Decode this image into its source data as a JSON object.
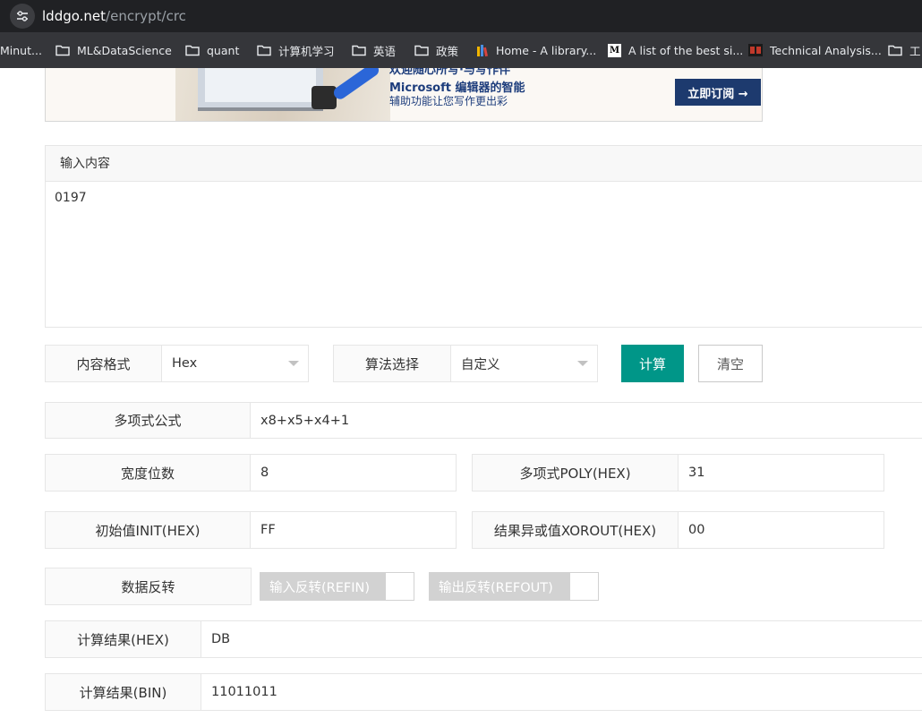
{
  "browser": {
    "url_host": "lddgo.net",
    "url_path": "/encrypt/crc",
    "bookmarks": [
      {
        "label": "Minut...",
        "icon": "none"
      },
      {
        "label": "ML&DataScience",
        "icon": "folder-icon"
      },
      {
        "label": "quant",
        "icon": "folder-icon"
      },
      {
        "label": "计算机学习",
        "icon": "folder-icon"
      },
      {
        "label": "英语",
        "icon": "folder-icon"
      },
      {
        "label": "政策",
        "icon": "folder-icon"
      },
      {
        "label": "Home - A library...",
        "icon": "library-favicon"
      },
      {
        "label": "A list of the best si...",
        "icon": "medium-favicon"
      },
      {
        "label": "Technical Analysis...",
        "icon": "ta-favicon"
      },
      {
        "label": "工",
        "icon": "folder-icon"
      }
    ]
  },
  "banner": {
    "line0": "欢迎随心所写·与写作伴",
    "line1": "Microsoft 编辑器的智能",
    "line2": "辅助功能让您写作更出彩",
    "cta": "立即订阅 →"
  },
  "input_panel": {
    "title": "输入内容",
    "value": "0197"
  },
  "options": {
    "content_format_label": "内容格式",
    "content_format_value": "Hex",
    "algorithm_label": "算法选择",
    "algorithm_value": "自定义",
    "calculate_button": "计算",
    "clear_button": "清空"
  },
  "params": {
    "polynomial_label": "多项式公式",
    "polynomial_value": "x8+x5+x4+1",
    "width_label": "宽度位数",
    "width_value": "8",
    "poly_hex_label": "多项式POLY(HEX)",
    "poly_hex_value": "31",
    "init_label": "初始值INIT(HEX)",
    "init_value": "FF",
    "xorout_label": "结果异或值XOROUT(HEX)",
    "xorout_value": "00",
    "reflect_label": "数据反转",
    "refin_label": "输入反转(REFIN)",
    "refout_label": "输出反转(REFOUT)"
  },
  "results": {
    "hex_label": "计算结果(HEX)",
    "hex_value": "DB",
    "bin_label": "计算结果(BIN)",
    "bin_value": "11011011"
  },
  "colors": {
    "primary": "#009688",
    "label_bg": "#fafafa",
    "border": "#e6e6e6",
    "switch_off": "#d2d2d2"
  }
}
